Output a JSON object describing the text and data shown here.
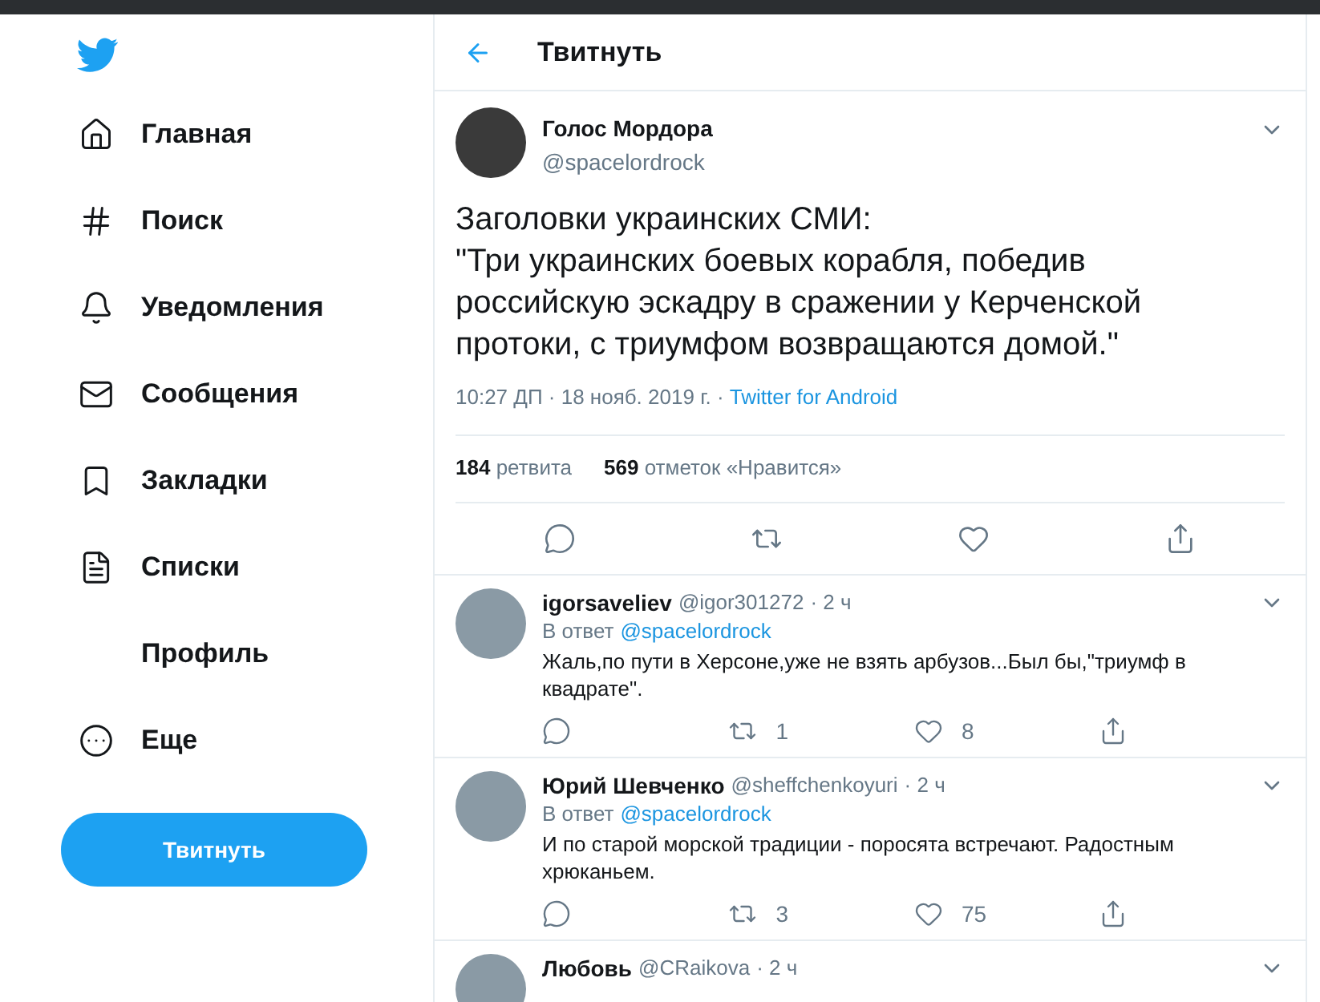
{
  "nav": {
    "items": [
      {
        "label": "Главная"
      },
      {
        "label": "Поиск"
      },
      {
        "label": "Уведомления"
      },
      {
        "label": "Сообщения"
      },
      {
        "label": "Закладки"
      },
      {
        "label": "Списки"
      },
      {
        "label": "Профиль"
      },
      {
        "label": "Еще"
      }
    ],
    "tweet_button": "Твитнуть"
  },
  "header": {
    "title": "Твитнуть"
  },
  "tweet": {
    "name": "Голос Мордора",
    "handle": "@spacelordrock",
    "text": "Заголовки украинских СМИ:\n\"Три украинских боевых корабля, победив российскую эскадру в сражении у Керченской протоки, с триумфом возвращаются домой.\"",
    "time": "10:27 ДП · 18 нояб. 2019 г. · ",
    "source": "Twitter for Android",
    "retweets_count": "184",
    "retweets_label": "ретвита",
    "likes_count": "569",
    "likes_label": "отметок «Нравится»"
  },
  "replies": [
    {
      "name": "igorsaveliev",
      "handle": "@igor301272",
      "age": "· 2 ч",
      "reply_to_label": "В ответ",
      "reply_to": "@spacelordrock",
      "text": "Жаль,по пути в Херсоне,уже не взять арбузов...Был бы,\"триумф в квадрате\".",
      "retweets": "1",
      "likes": "8"
    },
    {
      "name": "Юрий Шевченко",
      "handle": "@sheffchenkoyuri",
      "age": "· 2 ч",
      "reply_to_label": "В ответ",
      "reply_to": "@spacelordrock",
      "text": "И по старой морской традиции - поросята встречают. Радостным хрюканьем.",
      "retweets": "3",
      "likes": "75"
    },
    {
      "name": "Любовь",
      "handle": "@CRaikova",
      "age": "· 2 ч"
    }
  ]
}
